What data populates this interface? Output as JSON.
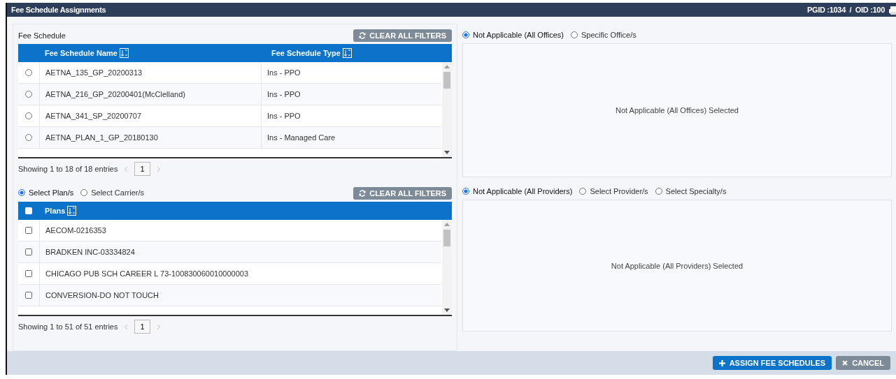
{
  "window": {
    "title": "Fee Schedule Assignments",
    "ids": "PGID :1034  /  OID :100"
  },
  "fee_schedule": {
    "label": "Fee Schedule",
    "clear_button": "CLEAR ALL FILTERS",
    "columns": [
      "Fee Schedule Name",
      "Fee Schedule Type"
    ],
    "rows": [
      {
        "name": "AETNA_135_GP_20200313",
        "type": "Ins - PPO",
        "selected": false
      },
      {
        "name": "AETNA_216_GP_20200401(McClelland)",
        "type": "Ins - PPO",
        "selected": false
      },
      {
        "name": "AETNA_341_SP_20200707",
        "type": "Ins - PPO",
        "selected": false
      },
      {
        "name": "AETNA_PLAN_1_GP_20180130",
        "type": "Ins - Managed Care",
        "selected": false
      }
    ],
    "info": "Showing 1 to 18 of 18 entries",
    "page": "1"
  },
  "office_options": [
    {
      "label": "Not Applicable (All Offices)",
      "selected": true
    },
    {
      "label": "Specific Office/s",
      "selected": false
    }
  ],
  "office_message": "Not Applicable (All Offices) Selected",
  "plan_options": [
    {
      "label": "Select Plan/s",
      "selected": true
    },
    {
      "label": "Select Carrier/s",
      "selected": false
    }
  ],
  "plans": {
    "clear_button": "CLEAR ALL FILTERS",
    "column": "Plans",
    "all_checked": false,
    "rows": [
      {
        "name": "AECOM-0216353",
        "checked": false
      },
      {
        "name": "BRADKEN INC-03334824",
        "checked": false
      },
      {
        "name": "CHICAGO PUB SCH CAREER L 73-100830060010000003",
        "checked": false
      },
      {
        "name": "CONVERSION-DO NOT TOUCH",
        "checked": false
      }
    ],
    "info": "Showing 1 to 51 of 51 entries",
    "page": "1"
  },
  "provider_options": [
    {
      "label": "Not Applicable (All Providers)",
      "selected": true
    },
    {
      "label": "Select Provider/s",
      "selected": false
    },
    {
      "label": "Select Specialty/s",
      "selected": false
    }
  ],
  "provider_message": "Not Applicable (All Providers) Selected",
  "buttons": [
    {
      "label": "ASSIGN FEE SCHEDULES",
      "kind": "primary"
    },
    {
      "label": "CANCEL",
      "kind": "cancel"
    }
  ]
}
